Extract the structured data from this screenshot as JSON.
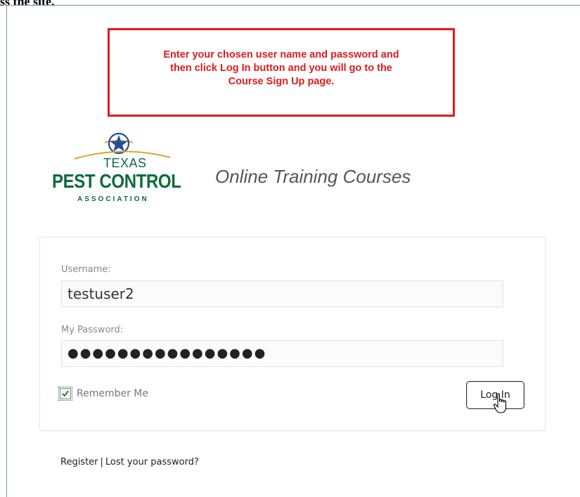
{
  "top_text": "ss the site.",
  "callout": {
    "line1": "Enter your chosen user name and password and",
    "line2": "then click Log In button and you will go to the",
    "line3": "Course Sign Up page."
  },
  "logo": {
    "texas": "TEXAS",
    "pest_control": "PEST CONTROL",
    "association": "ASSOCIATION"
  },
  "site_title": "Online Training Courses",
  "login": {
    "username_label": "Username:",
    "username_value": "testuser2",
    "password_label": "My Password:",
    "password_masked": "●●●●●●●●●●●●●●●●",
    "remember_label": "Remember Me",
    "remember_checked": true,
    "login_button": "Log In"
  },
  "links": {
    "register": "Register",
    "separator": "|",
    "lost_password": "Lost your password?"
  },
  "colors": {
    "callout_red": "#e01b1b",
    "logo_green": "#0c6d3a",
    "logo_blue": "#1f4e9c",
    "logo_gold": "#d9a72a"
  }
}
